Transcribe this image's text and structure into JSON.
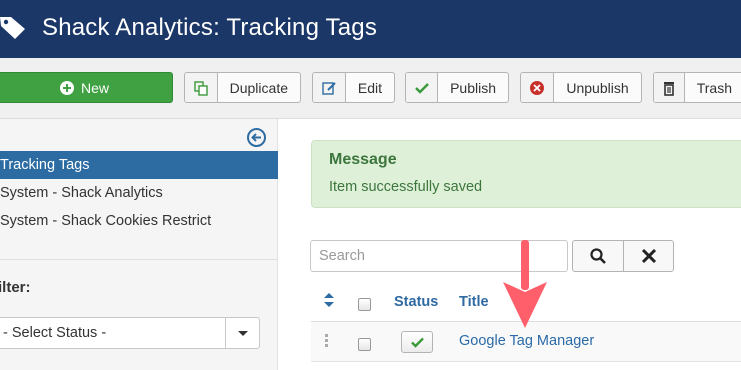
{
  "header": {
    "title": "Shack Analytics: Tracking Tags",
    "icon": "tag-icon",
    "color": "#1b3767"
  },
  "toolbar": {
    "new_label": "New",
    "duplicate_label": "Duplicate",
    "edit_label": "Edit",
    "publish_label": "Publish",
    "unpublish_label": "Unpublish",
    "trash_label": "Trash",
    "new_color": "#3fa142"
  },
  "sidebar": {
    "items": [
      {
        "label": "Tracking Tags",
        "active": true
      },
      {
        "label": "System - Shack Analytics",
        "active": false
      },
      {
        "label": "System - Shack Cookies Restrict",
        "active": false
      }
    ],
    "filter_label": "ilter:",
    "status_select": {
      "selected": "- Select Status -"
    }
  },
  "message": {
    "heading": "Message",
    "text": "Item successfully saved",
    "color": "#3c763d"
  },
  "search": {
    "placeholder": "Search",
    "value": ""
  },
  "table": {
    "columns": {
      "status": "Status",
      "title": "Title"
    },
    "rows": [
      {
        "title": "Google Tag Manager",
        "status": "published"
      }
    ]
  },
  "accent": "#2d6ca2",
  "annotation_arrow_color": "#ff5f6a"
}
